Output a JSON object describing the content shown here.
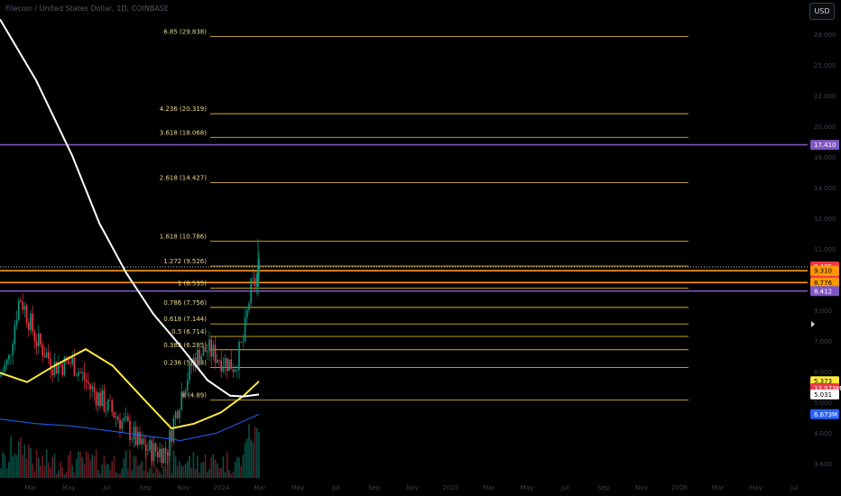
{
  "chart_title": "Filecoin / United States Dollar, 1D, COINBASE",
  "currency_button": "USD",
  "chart_data": {
    "type": "candlestick",
    "y_scale": "log",
    "ylim": [
      3.6,
      33
    ],
    "x_tick_labels": [
      "Mar",
      "May",
      "Jul",
      "Sep",
      "Nov",
      "2024",
      "Mar",
      "May",
      "Jul",
      "Sep",
      "Nov",
      "2025",
      "Mar",
      "May",
      "Jul",
      "Sep",
      "Nov",
      "2026",
      "Mar",
      "May",
      "Jul"
    ],
    "y_tick_labels": [
      "28.000",
      "25.000",
      "22.000",
      "20.000",
      "16.000",
      "14.000",
      "12.000",
      "11.000",
      "10.000",
      "9.000",
      "7.000",
      "6.000",
      "5.000",
      "4.000",
      "3.600"
    ],
    "fib_levels": [
      {
        "label": "6.85 (29.838)",
        "value": 29.838
      },
      {
        "label": "4.236 (20.319)",
        "value": 20.319
      },
      {
        "label": "3.618 (18.068)",
        "value": 18.068
      },
      {
        "label": "2.618 (14.427)",
        "value": 14.427
      },
      {
        "label": "1.618 (10.786)",
        "value": 10.786
      },
      {
        "label": "1.272 (9.526)",
        "value": 9.526
      },
      {
        "label": "1 (8.535)",
        "value": 8.535
      },
      {
        "label": "0.786 (7.756)",
        "value": 7.756
      },
      {
        "label": "0.618 (7.144)",
        "value": 7.144
      },
      {
        "label": "0.5 (6.714)",
        "value": 6.714
      },
      {
        "label": "0.382 (6.285)",
        "value": 6.285
      },
      {
        "label": "0.236 (5.753)",
        "value": 5.753
      },
      {
        "label": "0 (4.89)",
        "value": 4.89
      }
    ],
    "horizontal_lines": [
      {
        "value": 17.41,
        "color": "#7e57c2"
      },
      {
        "value": 8.412,
        "color": "#7e57c2"
      },
      {
        "value": 9.31,
        "color": "#ff9800"
      },
      {
        "value": 8.776,
        "color": "#ff9800"
      },
      {
        "value": 9.485,
        "color": "#ffffff"
      }
    ],
    "price_tags": [
      {
        "text": "17.410",
        "value": 17.41,
        "bg": "#7e57c2",
        "fg": "#ffffff"
      },
      {
        "text": "9.485",
        "sub": "04:52:05",
        "value": 9.485,
        "bg": "#f23645",
        "fg": "#ffffff"
      },
      {
        "text": "9.310",
        "value": 9.31,
        "bg": "#ff9800",
        "fg": "#000000"
      },
      {
        "text": "8.776",
        "value": 8.776,
        "bg": "#ff9800",
        "fg": "#000000"
      },
      {
        "text": "8.412",
        "value": 8.412,
        "bg": "#7e57c2",
        "fg": "#ffffff"
      },
      {
        "text": "5.373",
        "value": 5.373,
        "bg": "#ffeb3b",
        "fg": "#000000"
      },
      {
        "text": "12.573M",
        "value": 5.19,
        "bg": "#f23645",
        "fg": "#ffffff"
      },
      {
        "text": "5.031",
        "value": 5.031,
        "bg": "#ffffff",
        "fg": "#000000"
      },
      {
        "text": "6.673M",
        "value": 4.56,
        "bg": "#2962ff",
        "fg": "#ffffff"
      }
    ],
    "ma_white": [
      [
        0,
        32.5
      ],
      [
        40,
        24
      ],
      [
        80,
        16.5
      ],
      [
        110,
        11.8
      ],
      [
        140,
        9.2
      ],
      [
        170,
        7.5
      ],
      [
        200,
        6.4
      ],
      [
        230,
        5.4
      ],
      [
        255,
        5.0
      ],
      [
        270,
        4.98
      ],
      [
        287,
        5.03
      ]
    ],
    "ma_yellow": [
      [
        0,
        5.6
      ],
      [
        30,
        5.35
      ],
      [
        60,
        5.8
      ],
      [
        95,
        6.3
      ],
      [
        125,
        5.8
      ],
      [
        160,
        4.9
      ],
      [
        190,
        4.25
      ],
      [
        215,
        4.35
      ],
      [
        245,
        4.6
      ],
      [
        270,
        5.0
      ],
      [
        287,
        5.37
      ]
    ],
    "ma_blue": [
      [
        0,
        4.45
      ],
      [
        40,
        4.35
      ],
      [
        80,
        4.3
      ],
      [
        120,
        4.2
      ],
      [
        160,
        4.1
      ],
      [
        200,
        4.0
      ],
      [
        240,
        4.15
      ],
      [
        287,
        4.56
      ]
    ],
    "candle_keypoints": [
      [
        0,
        5.5
      ],
      [
        10,
        6.0
      ],
      [
        22,
        8.2
      ],
      [
        40,
        6.6
      ],
      [
        60,
        5.8
      ],
      [
        80,
        5.9
      ],
      [
        100,
        5.2
      ],
      [
        120,
        4.7
      ],
      [
        140,
        4.3
      ],
      [
        155,
        3.9
      ],
      [
        170,
        3.8
      ],
      [
        185,
        3.8
      ],
      [
        200,
        5.0
      ],
      [
        215,
        6.0
      ],
      [
        230,
        6.3
      ],
      [
        245,
        6.0
      ],
      [
        260,
        5.8
      ],
      [
        270,
        6.6
      ],
      [
        278,
        8.5
      ],
      [
        283,
        8.8
      ],
      [
        287,
        9.485
      ]
    ]
  }
}
